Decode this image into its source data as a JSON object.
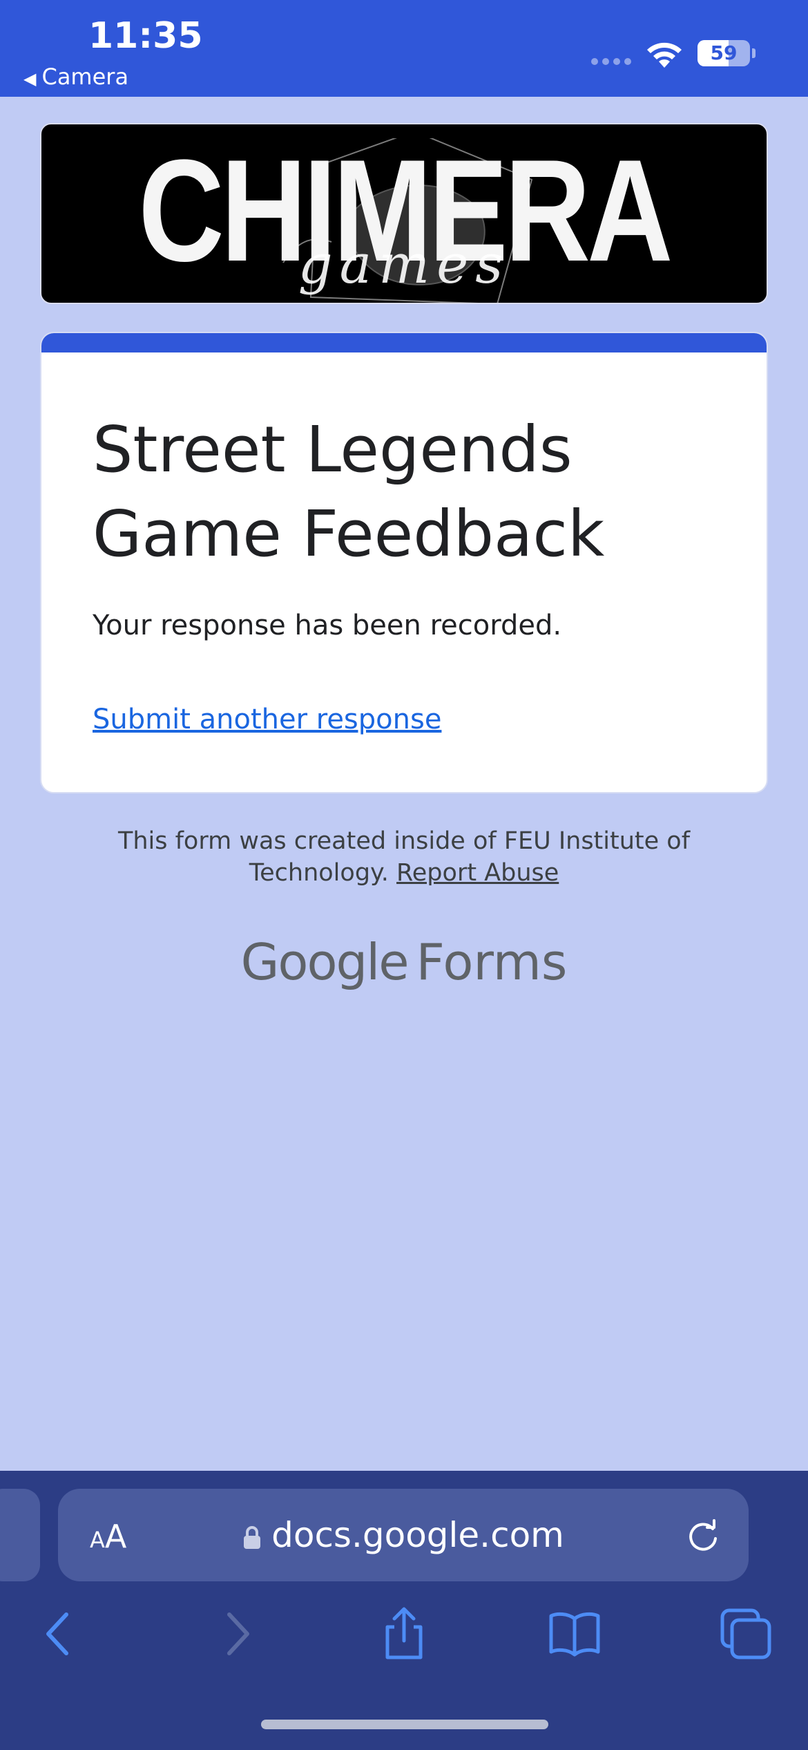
{
  "status_bar": {
    "time": "11:35",
    "back_app_label": "Camera",
    "battery_percent": 59
  },
  "banner": {
    "title": "CHIMERA",
    "subtitle": "games"
  },
  "form": {
    "title": "Street Legends Game Feedback",
    "confirmation": "Your response has been recorded.",
    "submit_another_link": "Submit another response"
  },
  "footer": {
    "created_text": "This form was created inside of FEU Institute of Technology.",
    "report_abuse_link": "Report Abuse",
    "google": "Google",
    "forms": "Forms"
  },
  "browser": {
    "text_size_small": "A",
    "text_size_large": "A",
    "url": "docs.google.com",
    "icons": [
      "lock-icon",
      "reload-icon",
      "back-icon",
      "forward-icon",
      "share-icon",
      "bookmarks-icon",
      "tabs-icon"
    ]
  },
  "colors": {
    "accent": "#3057d9",
    "page_background": "#c0cbf4",
    "link": "#1a66e0",
    "browser_bar": "#2c3d85"
  }
}
